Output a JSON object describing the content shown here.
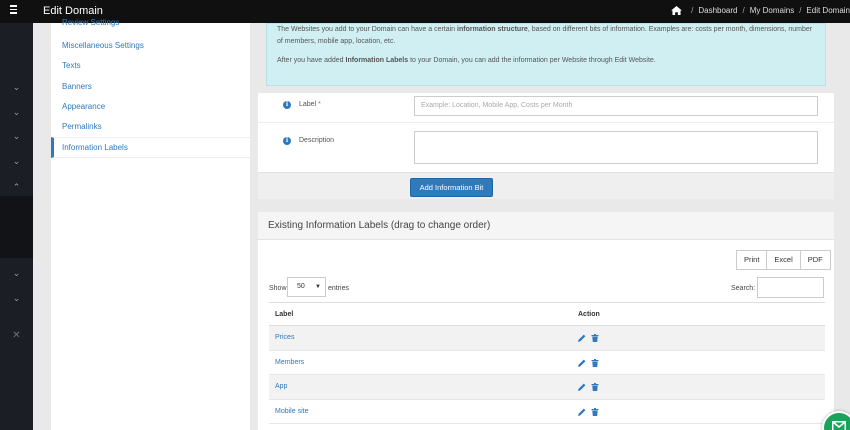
{
  "colors": {
    "accent": "#2f79bd",
    "topbar": "#101010",
    "rail": "#1b1e24",
    "info_bg": "#cfeff2",
    "chat": "#1aa35a"
  },
  "topbar": {
    "title": "Edit Domain",
    "breadcrumbs": [
      "Dashboard",
      "My Domains",
      "Edit Domain"
    ]
  },
  "rail": {
    "icons": [
      "chevron-down-icon",
      "chevron-down-icon",
      "chevron-down-icon",
      "chevron-down-icon",
      "chevron-up-icon",
      "chevron-down-icon",
      "chevron-down-icon",
      "close-icon"
    ]
  },
  "submenu": {
    "items": [
      {
        "label": "Review Settings"
      },
      {
        "label": "Miscellaneous Settings"
      },
      {
        "label": "Texts"
      },
      {
        "label": "Banners"
      },
      {
        "label": "Appearance"
      },
      {
        "label": "Permalinks"
      },
      {
        "label": "Information Labels"
      }
    ],
    "active_index": 6
  },
  "info_box": {
    "p1_before": "The Websites you add to your Domain can have a certain ",
    "p1_bold": "information structure",
    "p1_after": ", based on different bits of information. Examples are: costs per month, dimensions, number of members, mobile app, location, etc.",
    "p2_before": "After you have added ",
    "p2_bold": "Information Labels",
    "p2_after": " to your Domain, you can add the information per Website through Edit Website."
  },
  "form": {
    "label_field": {
      "label": "Label",
      "required_mark": "*",
      "placeholder": "Example: Location, Mobile App, Costs per Month",
      "value": ""
    },
    "description_field": {
      "label": "Description",
      "value": ""
    },
    "submit_label": "Add Information Bit"
  },
  "list": {
    "title": "Existing Information Labels (drag to change order)",
    "export_buttons": [
      "Print",
      "Excel",
      "PDF"
    ],
    "show_label": "Show",
    "entries_value": "50",
    "entries_label": "entries",
    "search_label": "Search:",
    "columns": [
      "Label",
      "Action"
    ],
    "rows": [
      {
        "label": "Prices"
      },
      {
        "label": "Members"
      },
      {
        "label": "App"
      },
      {
        "label": "Mobile site"
      }
    ]
  }
}
